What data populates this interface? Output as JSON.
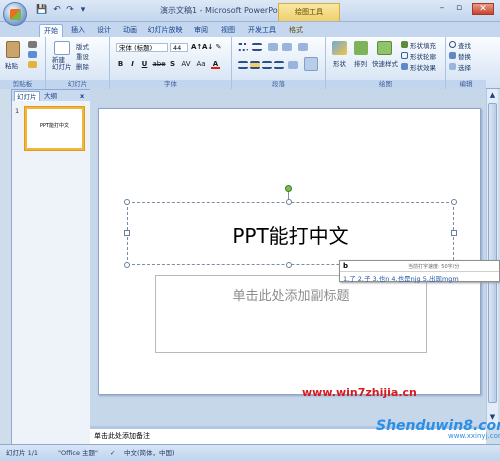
{
  "window": {
    "title": "演示文稿1 - Microsoft PowerPoint",
    "context_tab_title": "绘图工具",
    "qat": {
      "save": "💾",
      "undo": "↶",
      "redo": "↷",
      "more": "▾"
    },
    "controls": {
      "minimize": "–",
      "maximize": "▫",
      "close": "✕"
    }
  },
  "tabs": [
    "开始",
    "插入",
    "设计",
    "动画",
    "幻灯片放映",
    "审阅",
    "视图",
    "开发工具",
    "格式"
  ],
  "ribbon": {
    "clipboard": {
      "label": "剪贴板",
      "paste": "粘贴"
    },
    "slides": {
      "label": "幻灯片",
      "new_slide": "新建\n幻灯片",
      "layout": "版式",
      "reset": "重设",
      "delete": "删除"
    },
    "font": {
      "label": "字体",
      "font_name": "宋体 (标题)",
      "font_size": "44",
      "bold": "B",
      "italic": "I",
      "underline": "U",
      "strike": "abe",
      "shadow": "S",
      "spacing": "AV",
      "case": "Aa",
      "color": "A",
      "grow": "A↑",
      "shrink": "A↓",
      "clear": "✎"
    },
    "paragraph": {
      "label": "段落"
    },
    "drawing": {
      "label": "绘图",
      "shapes": "形状",
      "arrange": "排列",
      "quick_styles": "快速样式",
      "fill": "形状填充",
      "outline": "形状轮廓",
      "effects": "形状效果"
    },
    "editing": {
      "label": "编辑",
      "find": "查找",
      "replace": "替换",
      "select": "选择"
    }
  },
  "side_panel": {
    "tab_slides": "幻灯片",
    "tab_outline": "大纲",
    "close": "x",
    "thumb_number": "1",
    "thumb_text": "PPT能打中文"
  },
  "slide": {
    "title_text": "PPT能打中文",
    "subtitle_placeholder": "单击此处添加副标题"
  },
  "ime": {
    "composition": "b",
    "speed": "当前打字速度: 50字/分",
    "candidates": "1.了 2.子 3.也n 4.也是njg 5.出现mgm"
  },
  "notes": {
    "placeholder": "单击此处添加备注"
  },
  "status": {
    "slide_info": "幻灯片 1/1",
    "theme": "\"Office 主题\"",
    "language": "中文(简体，中国)"
  },
  "watermark": {
    "url": "www.win7zhijia.cn",
    "brand": "Shenduwin8.com",
    "site": "www.xxinyj.com"
  },
  "colors": {
    "accent": "#15428b",
    "selection": "#f3b53b",
    "watermark_red": "#d71920",
    "watermark_blue": "#2a8fe6"
  }
}
